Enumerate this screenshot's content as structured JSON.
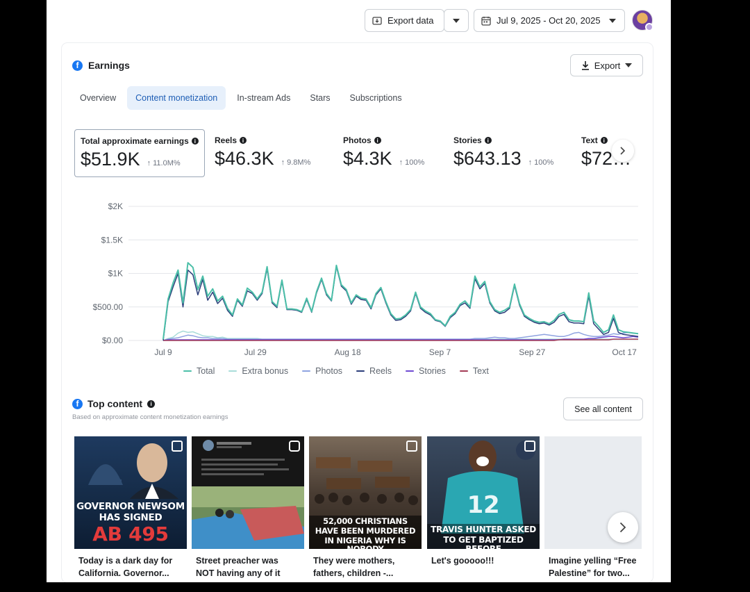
{
  "topbar": {
    "export_data_label": "Export data",
    "date_range_label": "Jul 9, 2025 - Oct 20, 2025"
  },
  "earnings": {
    "title": "Earnings",
    "export_label": "Export",
    "tabs": [
      {
        "label": "Overview",
        "active": false
      },
      {
        "label": "Content monetization",
        "active": true
      },
      {
        "label": "In-stream Ads",
        "active": false
      },
      {
        "label": "Stars",
        "active": false
      },
      {
        "label": "Subscriptions",
        "active": false
      }
    ],
    "metrics": [
      {
        "label": "Total approximate earnings",
        "value": "$51.9K",
        "change": "↑ 11.0M%"
      },
      {
        "label": "Reels",
        "value": "$46.3K",
        "change": "↑ 9.8M%"
      },
      {
        "label": "Photos",
        "value": "$4.3K",
        "change": "↑ 100%"
      },
      {
        "label": "Stories",
        "value": "$643.13",
        "change": "↑ 100%"
      },
      {
        "label": "Text",
        "value": "$72…",
        "change": ""
      }
    ]
  },
  "chart_data": {
    "type": "line",
    "y_ticks": [
      "$2K",
      "$1.5K",
      "$1K",
      "$500.00",
      "$0.00"
    ],
    "x_ticks": [
      "Jul 9",
      "Jul 29",
      "Aug 18",
      "Sep 7",
      "Sep 27",
      "Oct 17"
    ],
    "ylim": [
      0,
      2000
    ],
    "grid": true,
    "legend_position": "bottom",
    "x_start": "2025-07-09",
    "x_end": "2025-10-20",
    "series": [
      {
        "name": "Total",
        "color": "#4bbfa8",
        "values": [
          20,
          620,
          860,
          1050,
          560,
          1160,
          1090,
          760,
          960,
          660,
          770,
          590,
          660,
          480,
          380,
          620,
          530,
          780,
          720,
          620,
          720,
          1100,
          580,
          510,
          900,
          470,
          470,
          460,
          430,
          630,
          430,
          730,
          930,
          700,
          600,
          1120,
          830,
          760,
          560,
          680,
          630,
          620,
          490,
          700,
          790,
          580,
          400,
          320,
          330,
          380,
          460,
          720,
          500,
          440,
          400,
          310,
          290,
          220,
          360,
          420,
          540,
          590,
          500,
          960,
          800,
          880,
          580,
          460,
          420,
          450,
          500,
          840,
          550,
          380,
          330,
          290,
          270,
          280,
          250,
          300,
          390,
          420,
          310,
          290,
          290,
          280,
          710,
          290,
          210,
          120,
          160,
          380,
          160,
          130,
          120,
          110,
          100
        ]
      },
      {
        "name": "Extra bonus",
        "color": "#a8dcd9",
        "values": [
          0,
          30,
          50,
          110,
          140,
          120,
          130,
          100,
          70,
          60,
          60,
          40,
          50,
          30,
          30,
          30,
          30,
          30,
          30,
          30,
          20,
          20,
          20,
          20,
          20,
          20,
          20,
          20,
          20,
          20,
          20,
          20,
          20,
          20,
          20,
          20,
          20,
          20,
          20,
          20,
          20,
          20,
          20,
          20,
          20,
          20,
          20,
          20,
          20,
          20,
          20,
          20,
          20,
          20,
          20,
          20,
          20,
          20,
          20,
          20,
          20,
          20,
          20,
          20,
          20,
          20,
          20,
          20,
          20,
          20,
          20,
          20,
          20,
          20,
          20,
          20,
          20,
          20,
          20,
          20,
          20,
          20,
          20,
          20,
          20,
          20,
          20,
          20,
          20,
          20,
          20,
          20,
          20,
          20,
          20,
          20,
          20
        ]
      },
      {
        "name": "Photos",
        "color": "#8ea3e0",
        "values": [
          0,
          20,
          30,
          40,
          60,
          80,
          70,
          50,
          40,
          40,
          30,
          30,
          30,
          20,
          20,
          20,
          20,
          20,
          20,
          20,
          20,
          20,
          20,
          20,
          20,
          20,
          20,
          20,
          20,
          20,
          20,
          20,
          20,
          20,
          20,
          20,
          20,
          20,
          20,
          20,
          20,
          20,
          20,
          20,
          20,
          20,
          20,
          20,
          20,
          20,
          20,
          20,
          20,
          20,
          20,
          20,
          20,
          20,
          20,
          20,
          20,
          20,
          20,
          30,
          30,
          30,
          40,
          50,
          40,
          40,
          30,
          30,
          40,
          50,
          60,
          70,
          80,
          90,
          80,
          70,
          60,
          60,
          80,
          110,
          120,
          90,
          70,
          60,
          60,
          70,
          80,
          100,
          90,
          110,
          120,
          110,
          100
        ]
      },
      {
        "name": "Reels",
        "color": "#2c3e7a",
        "values": [
          0,
          580,
          800,
          1000,
          500,
          1050,
          980,
          680,
          910,
          600,
          720,
          550,
          630,
          450,
          360,
          600,
          510,
          740,
          700,
          600,
          700,
          1070,
          560,
          490,
          880,
          460,
          460,
          450,
          420,
          610,
          420,
          710,
          910,
          680,
          590,
          1100,
          810,
          740,
          540,
          660,
          610,
          600,
          470,
          680,
          770,
          560,
          380,
          300,
          310,
          360,
          440,
          700,
          480,
          420,
          380,
          300,
          280,
          210,
          340,
          400,
          520,
          560,
          480,
          920,
          770,
          850,
          560,
          440,
          400,
          420,
          480,
          820,
          530,
          360,
          310,
          270,
          250,
          260,
          230,
          270,
          360,
          390,
          280,
          260,
          260,
          250,
          660,
          250,
          170,
          90,
          120,
          330,
          120,
          90,
          80,
          70,
          60
        ]
      },
      {
        "name": "Stories",
        "color": "#6e4ad2",
        "values": [
          0,
          10,
          10,
          10,
          10,
          10,
          10,
          10,
          10,
          10,
          10,
          10,
          10,
          10,
          10,
          10,
          10,
          10,
          10,
          10,
          10,
          10,
          10,
          10,
          10,
          10,
          10,
          10,
          10,
          10,
          10,
          10,
          10,
          10,
          10,
          10,
          10,
          10,
          10,
          10,
          10,
          10,
          10,
          10,
          10,
          10,
          10,
          10,
          10,
          10,
          10,
          10,
          10,
          10,
          10,
          10,
          10,
          10,
          10,
          10,
          10,
          10,
          10,
          10,
          10,
          10,
          10,
          10,
          10,
          10,
          10,
          10,
          10,
          10,
          10,
          10,
          10,
          10,
          10,
          10,
          10,
          20,
          20,
          20,
          20,
          20,
          30,
          30,
          40,
          50,
          60,
          60,
          50,
          40,
          50,
          60,
          50
        ]
      },
      {
        "name": "Text",
        "color": "#a33b55",
        "values": [
          0,
          0,
          0,
          0,
          0,
          0,
          0,
          0,
          0,
          0,
          0,
          0,
          0,
          0,
          0,
          0,
          0,
          0,
          0,
          0,
          0,
          0,
          0,
          0,
          0,
          0,
          0,
          0,
          0,
          0,
          0,
          0,
          0,
          0,
          0,
          0,
          0,
          0,
          0,
          0,
          0,
          0,
          0,
          0,
          0,
          0,
          0,
          0,
          0,
          0,
          0,
          0,
          0,
          0,
          0,
          0,
          0,
          0,
          0,
          0,
          0,
          0,
          0,
          0,
          0,
          0,
          0,
          0,
          0,
          0,
          0,
          0,
          0,
          0,
          0,
          0,
          0,
          0,
          0,
          0,
          10,
          10,
          10,
          10,
          10,
          10,
          10,
          10,
          10,
          10,
          10,
          20,
          20,
          20,
          20,
          20,
          20
        ]
      }
    ]
  },
  "top_content": {
    "title": "Top content",
    "subtitle": "Based on approximate content monetization earnings",
    "see_all_label": "See all content",
    "items": [
      {
        "caption_line1": "Today is a dark day for",
        "caption_line2": "California. Governor...",
        "overlay_l1": "GOVERNOR NEWSOM",
        "overlay_l2": "HAS SIGNED",
        "overlay_l3": "AB 495"
      },
      {
        "caption_line1": "Street preacher was",
        "caption_line2": "NOT having any of it",
        "overlay_l1": "",
        "overlay_l2": "",
        "overlay_l3": ""
      },
      {
        "caption_line1": "They were mothers,",
        "caption_line2": "fathers, children -...",
        "overlay_l1": "52,000 CHRISTIANS",
        "overlay_l2": "HAVE BEEN MURDERED",
        "overlay_l3": "IN NIGERIA WHY IS NOBODY"
      },
      {
        "caption_line1": "Let's gooooo!!!",
        "caption_line2": "",
        "overlay_l1": "TRAVIS HUNTER ASKED",
        "overlay_l2": "TO GET BAPTIZED BEFORE",
        "overlay_l3": "12"
      },
      {
        "caption_line1": "Imagine yelling “Free",
        "caption_line2": "Palestine” for two...",
        "overlay_l1": "",
        "overlay_l2": "",
        "overlay_l3": ""
      }
    ]
  },
  "colors": {
    "accent": "#1877f2",
    "active_tab_bg": "#e7f0fb",
    "active_tab_text": "#1e5eb5"
  },
  "icons": [
    "export-data-icon",
    "chevron-down-icon",
    "calendar-icon",
    "download-icon",
    "facebook-icon",
    "info-icon",
    "chevron-right-icon",
    "photo-type-icon",
    "reel-type-icon"
  ]
}
